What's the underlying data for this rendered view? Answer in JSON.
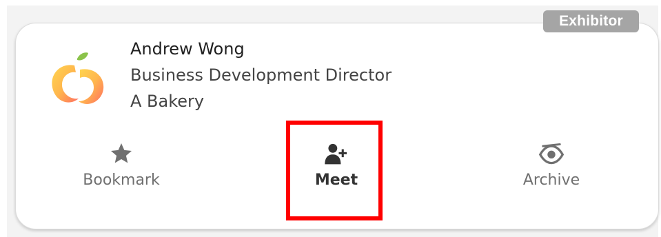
{
  "badge": {
    "label": "Exhibitor"
  },
  "contact": {
    "name": "Andrew Wong",
    "title": "Business Development Director",
    "company": "A Bakery"
  },
  "logo": {
    "icon": "apple-swirl-logo",
    "colors": [
      "#8bc34a",
      "#ffc107",
      "#ff7043"
    ]
  },
  "actions": [
    {
      "id": "bookmark",
      "label": "Bookmark",
      "icon": "star-icon"
    },
    {
      "id": "meet",
      "label": "Meet",
      "icon": "add-user-icon"
    },
    {
      "id": "archive",
      "label": "Archive",
      "icon": "eye-slash-icon"
    }
  ],
  "colors": {
    "highlight": "#ff0000",
    "badge_bg": "#a5a5a5",
    "icon_gray": "#707070",
    "meet_dark": "#333333"
  }
}
